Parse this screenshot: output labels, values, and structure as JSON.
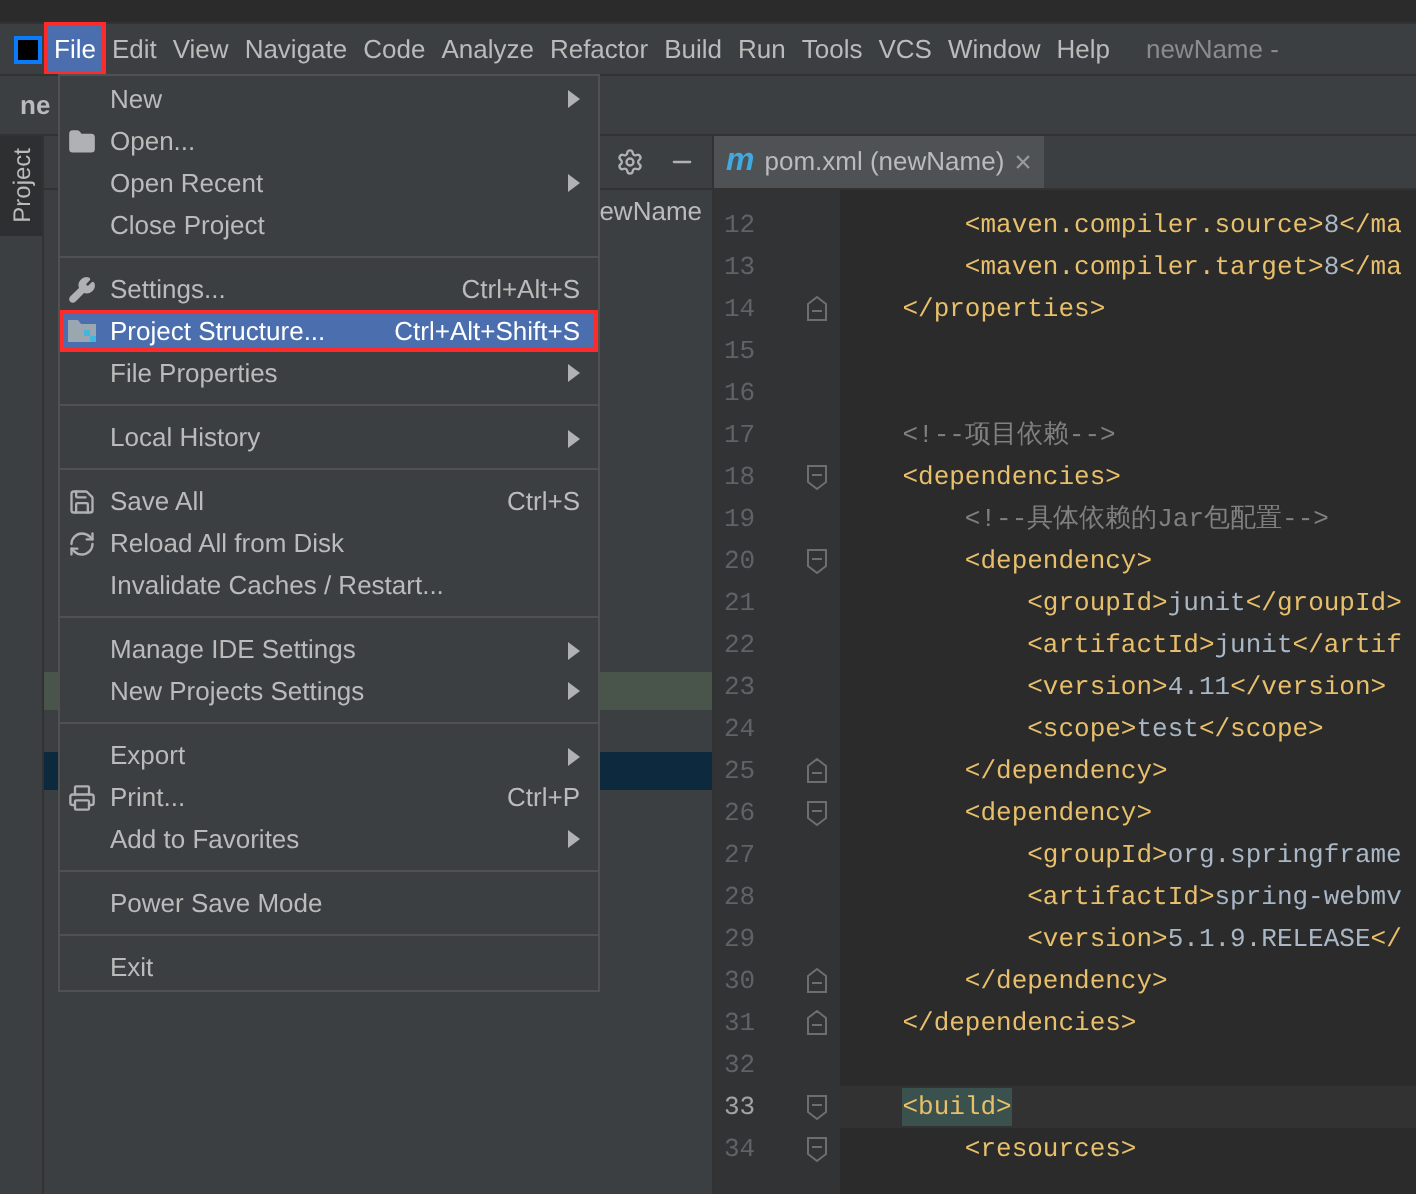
{
  "menubar": {
    "items": [
      {
        "label": "File",
        "selected": true,
        "outlined": true
      },
      {
        "label": "Edit",
        "selected": false,
        "outlined": false
      },
      {
        "label": "View",
        "selected": false,
        "outlined": false
      },
      {
        "label": "Navigate",
        "selected": false,
        "outlined": false
      },
      {
        "label": "Code",
        "selected": false,
        "outlined": false
      },
      {
        "label": "Analyze",
        "selected": false,
        "outlined": false
      },
      {
        "label": "Refactor",
        "selected": false,
        "outlined": false
      },
      {
        "label": "Build",
        "selected": false,
        "outlined": false
      },
      {
        "label": "Run",
        "selected": false,
        "outlined": false
      },
      {
        "label": "Tools",
        "selected": false,
        "outlined": false
      },
      {
        "label": "VCS",
        "selected": false,
        "outlined": false
      },
      {
        "label": "Window",
        "selected": false,
        "outlined": false
      },
      {
        "label": "Help",
        "selected": false,
        "outlined": false
      }
    ],
    "window_title": "newName -"
  },
  "navigation_bar": {
    "project": "ne"
  },
  "tool_strip": {
    "tab": "Project",
    "selected": true
  },
  "project_panel": {
    "visible_text": "ewName",
    "rows": [
      {
        "kind": "match"
      },
      {
        "kind": "selection"
      }
    ]
  },
  "file_menu": {
    "items": [
      {
        "kind": "plain",
        "label": "New",
        "submenu": true,
        "separator_before": false,
        "selected": false,
        "outlined": false
      },
      {
        "kind": "folder",
        "label": "Open...",
        "submenu": false,
        "separator_before": false,
        "selected": false,
        "outlined": false
      },
      {
        "kind": "plain",
        "label": "Open Recent",
        "submenu": true,
        "separator_before": false,
        "selected": false,
        "outlined": false
      },
      {
        "kind": "plain",
        "label": "Close Project",
        "submenu": false,
        "separator_before": false,
        "selected": false,
        "outlined": false
      },
      {
        "kind": "wrench",
        "label": "Settings...",
        "shortcut": "Ctrl+Alt+S",
        "submenu": false,
        "separator_before": true,
        "selected": false,
        "outlined": false
      },
      {
        "kind": "structure",
        "label": "Project Structure...",
        "shortcut": "Ctrl+Alt+Shift+S",
        "submenu": false,
        "separator_before": false,
        "selected": true,
        "outlined": true
      },
      {
        "kind": "plain",
        "label": "File Properties",
        "submenu": true,
        "separator_before": false,
        "selected": false,
        "outlined": false
      },
      {
        "kind": "plain",
        "label": "Local History",
        "submenu": true,
        "separator_before": true,
        "selected": false,
        "outlined": false
      },
      {
        "kind": "disk",
        "label": "Save All",
        "shortcut": "Ctrl+S",
        "submenu": false,
        "separator_before": true,
        "selected": false,
        "outlined": false
      },
      {
        "kind": "reload",
        "label": "Reload All from Disk",
        "submenu": false,
        "separator_before": false,
        "selected": false,
        "outlined": false
      },
      {
        "kind": "plain",
        "label": "Invalidate Caches / Restart...",
        "submenu": false,
        "separator_before": false,
        "selected": false,
        "outlined": false
      },
      {
        "kind": "plain",
        "label": "Manage IDE Settings",
        "submenu": true,
        "separator_before": true,
        "selected": false,
        "outlined": false
      },
      {
        "kind": "plain",
        "label": "New Projects Settings",
        "submenu": true,
        "separator_before": false,
        "selected": false,
        "outlined": false
      },
      {
        "kind": "plain",
        "label": "Export",
        "submenu": true,
        "separator_before": true,
        "selected": false,
        "outlined": false
      },
      {
        "kind": "printer",
        "label": "Print...",
        "shortcut": "Ctrl+P",
        "submenu": false,
        "separator_before": false,
        "selected": false,
        "outlined": false
      },
      {
        "kind": "plain",
        "label": "Add to Favorites",
        "submenu": true,
        "separator_before": false,
        "selected": false,
        "outlined": false
      },
      {
        "kind": "plain",
        "label": "Power Save Mode",
        "submenu": false,
        "separator_before": true,
        "selected": false,
        "outlined": false
      },
      {
        "kind": "plain",
        "label": "Exit",
        "submenu": false,
        "separator_before": true,
        "selected": false,
        "outlined": false
      }
    ]
  },
  "editor": {
    "tab": {
      "icon": "m",
      "label": "pom.xml (newName)",
      "close": "×"
    },
    "lines": [
      {
        "number": "12",
        "kind": "plain",
        "current": false,
        "parts": [
          {
            "kind": "tag",
            "text": "        <maven.compiler.source>"
          },
          {
            "kind": "text",
            "text": "8"
          },
          {
            "kind": "tag",
            "text": "</ma"
          }
        ]
      },
      {
        "number": "13",
        "kind": "plain",
        "current": false,
        "parts": [
          {
            "kind": "tag",
            "text": "        <maven.compiler.target>"
          },
          {
            "kind": "text",
            "text": "8"
          },
          {
            "kind": "tag",
            "text": "</ma"
          }
        ]
      },
      {
        "number": "14",
        "kind": "fold_end",
        "current": false,
        "parts": [
          {
            "kind": "tag",
            "text": "    </properties>"
          }
        ]
      },
      {
        "number": "15",
        "kind": "plain",
        "current": false
      },
      {
        "number": "16",
        "kind": "plain",
        "current": false
      },
      {
        "number": "17",
        "kind": "plain",
        "current": false,
        "parts": [
          {
            "kind": "comment",
            "text": "    <!--项目依赖-->"
          }
        ]
      },
      {
        "number": "18",
        "kind": "fold_start",
        "current": false,
        "parts": [
          {
            "kind": "tag",
            "text": "    <dependencies>"
          }
        ]
      },
      {
        "number": "19",
        "kind": "plain",
        "current": false,
        "parts": [
          {
            "kind": "comment",
            "text": "        <!--具体依赖的Jar包配置-->"
          }
        ]
      },
      {
        "number": "20",
        "kind": "fold_start",
        "current": false,
        "parts": [
          {
            "kind": "tag",
            "text": "        <dependency>"
          }
        ]
      },
      {
        "number": "21",
        "kind": "plain",
        "current": false,
        "parts": [
          {
            "kind": "tag",
            "text": "            <groupId>"
          },
          {
            "kind": "text",
            "text": "junit"
          },
          {
            "kind": "tag",
            "text": "</groupId>"
          }
        ]
      },
      {
        "number": "22",
        "kind": "plain",
        "current": false,
        "parts": [
          {
            "kind": "tag",
            "text": "            <artifactId>"
          },
          {
            "kind": "text",
            "text": "junit"
          },
          {
            "kind": "tag",
            "text": "</artif"
          }
        ]
      },
      {
        "number": "23",
        "kind": "plain",
        "current": false,
        "parts": [
          {
            "kind": "tag",
            "text": "            <version>"
          },
          {
            "kind": "text",
            "text": "4.11"
          },
          {
            "kind": "tag",
            "text": "</version>"
          }
        ]
      },
      {
        "number": "24",
        "kind": "plain",
        "current": false,
        "parts": [
          {
            "kind": "tag",
            "text": "            <scope>"
          },
          {
            "kind": "text",
            "text": "test"
          },
          {
            "kind": "tag",
            "text": "</scope>"
          }
        ]
      },
      {
        "number": "25",
        "kind": "fold_end",
        "current": false,
        "parts": [
          {
            "kind": "tag",
            "text": "        </dependency>"
          }
        ]
      },
      {
        "number": "26",
        "kind": "fold_start",
        "current": false,
        "parts": [
          {
            "kind": "tag",
            "text": "        <dependency>"
          }
        ]
      },
      {
        "number": "27",
        "kind": "plain",
        "current": false,
        "parts": [
          {
            "kind": "tag",
            "text": "            <groupId>"
          },
          {
            "kind": "text",
            "text": "org.springframe"
          }
        ]
      },
      {
        "number": "28",
        "kind": "plain",
        "current": false,
        "parts": [
          {
            "kind": "tag",
            "text": "            <artifactId>"
          },
          {
            "kind": "text",
            "text": "spring-webmv"
          }
        ]
      },
      {
        "number": "29",
        "kind": "plain",
        "current": false,
        "parts": [
          {
            "kind": "tag",
            "text": "            <version>"
          },
          {
            "kind": "text",
            "text": "5.1.9.RELEASE"
          },
          {
            "kind": "tag",
            "text": "</"
          }
        ]
      },
      {
        "number": "30",
        "kind": "fold_end",
        "current": false,
        "parts": [
          {
            "kind": "tag",
            "text": "        </dependency>"
          }
        ]
      },
      {
        "number": "31",
        "kind": "fold_end",
        "current": false,
        "parts": [
          {
            "kind": "tag",
            "text": "    </dependencies>"
          }
        ]
      },
      {
        "number": "32",
        "kind": "plain",
        "current": false
      },
      {
        "number": "33",
        "kind": "fold_start",
        "current": true,
        "parts": [
          {
            "kind": "matched",
            "text": "    <build>"
          }
        ]
      },
      {
        "number": "34",
        "kind": "fold_start",
        "current": false,
        "parts": [
          {
            "kind": "tag",
            "text": "        <resources>"
          }
        ]
      }
    ]
  }
}
